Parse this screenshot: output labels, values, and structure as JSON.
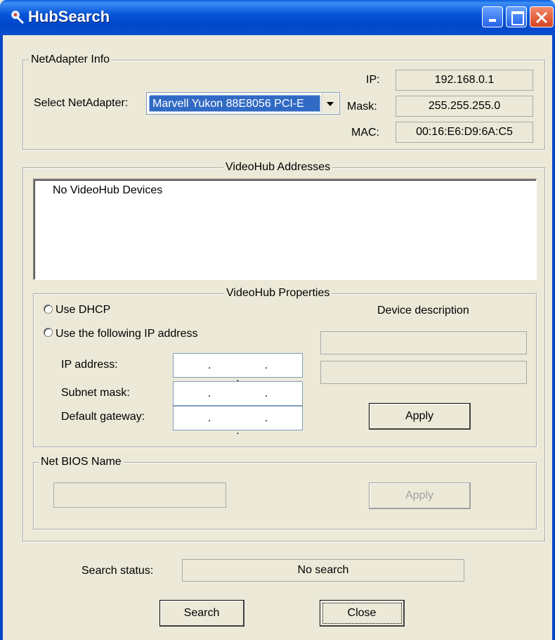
{
  "window": {
    "title": "HubSearch",
    "accent": "#0a4fd0",
    "icon": "hubsearch-app-icon"
  },
  "netadapter": {
    "legend": "NetAdapter Info",
    "select_label": "Select NetAdapter:",
    "selected_value": "Marvell Yukon 88E8056 PCI-E",
    "ip_label": "IP:",
    "ip_value": "192.168.0.1",
    "mask_label": "Mask:",
    "mask_value": "255.255.255.0",
    "mac_label": "MAC:",
    "mac_value": "00:16:E6:D9:6A:C5"
  },
  "addresses": {
    "legend": "VideoHub Addresses",
    "items": [
      "No VideoHub Devices"
    ]
  },
  "properties": {
    "legend": "VideoHub Properties",
    "use_dhcp": "Use DHCP",
    "use_static": "Use the following IP address",
    "ip_label": "IP address:",
    "subnet_label": "Subnet mask:",
    "gateway_label": "Default gateway:",
    "ip_placeholder": ". . .",
    "device_description_label": "Device description",
    "apply_label": "Apply"
  },
  "netbios": {
    "legend": "Net BIOS Name",
    "apply_label": "Apply"
  },
  "status": {
    "label": "Search status:",
    "value": "No search"
  },
  "footer": {
    "search_label": "Search",
    "close_label": "Close"
  }
}
